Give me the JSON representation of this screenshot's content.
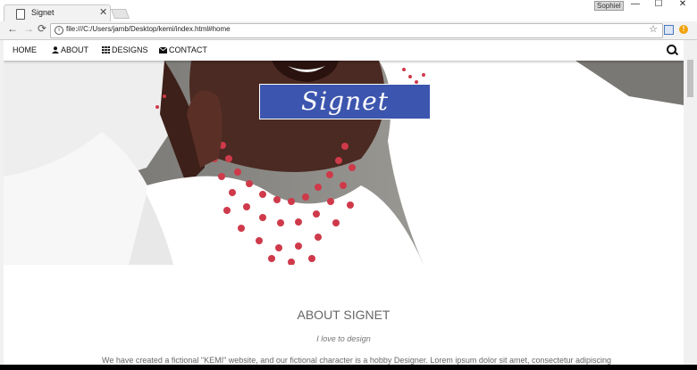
{
  "browser": {
    "tab_title": "Signet",
    "profile": "Sophiel",
    "url": "file:///C:/Users/jamb/Desktop/kemi/index.html#home",
    "window_controls": {
      "minimize": "—",
      "maximize": "☐",
      "close": "✕"
    }
  },
  "nav": {
    "items": [
      {
        "label": "HOME",
        "icon": ""
      },
      {
        "label": "ABOUT",
        "icon": "user-icon"
      },
      {
        "label": "DESIGNS",
        "icon": "grid-icon"
      },
      {
        "label": "CONTACT",
        "icon": "envelope-icon"
      }
    ]
  },
  "hero": {
    "logo_text": "Signet"
  },
  "about": {
    "title": "ABOUT SIGNET",
    "subtitle": "I love to design",
    "body": "We have created a fictional \"KEMI\" website, and our fictional character is a hobby Designer. Lorem ipsum dolor sit amet, consectetur adipiscing"
  },
  "colors": {
    "logo_bg": "#3c55ae",
    "necklace_red": "#cf3a4a"
  }
}
